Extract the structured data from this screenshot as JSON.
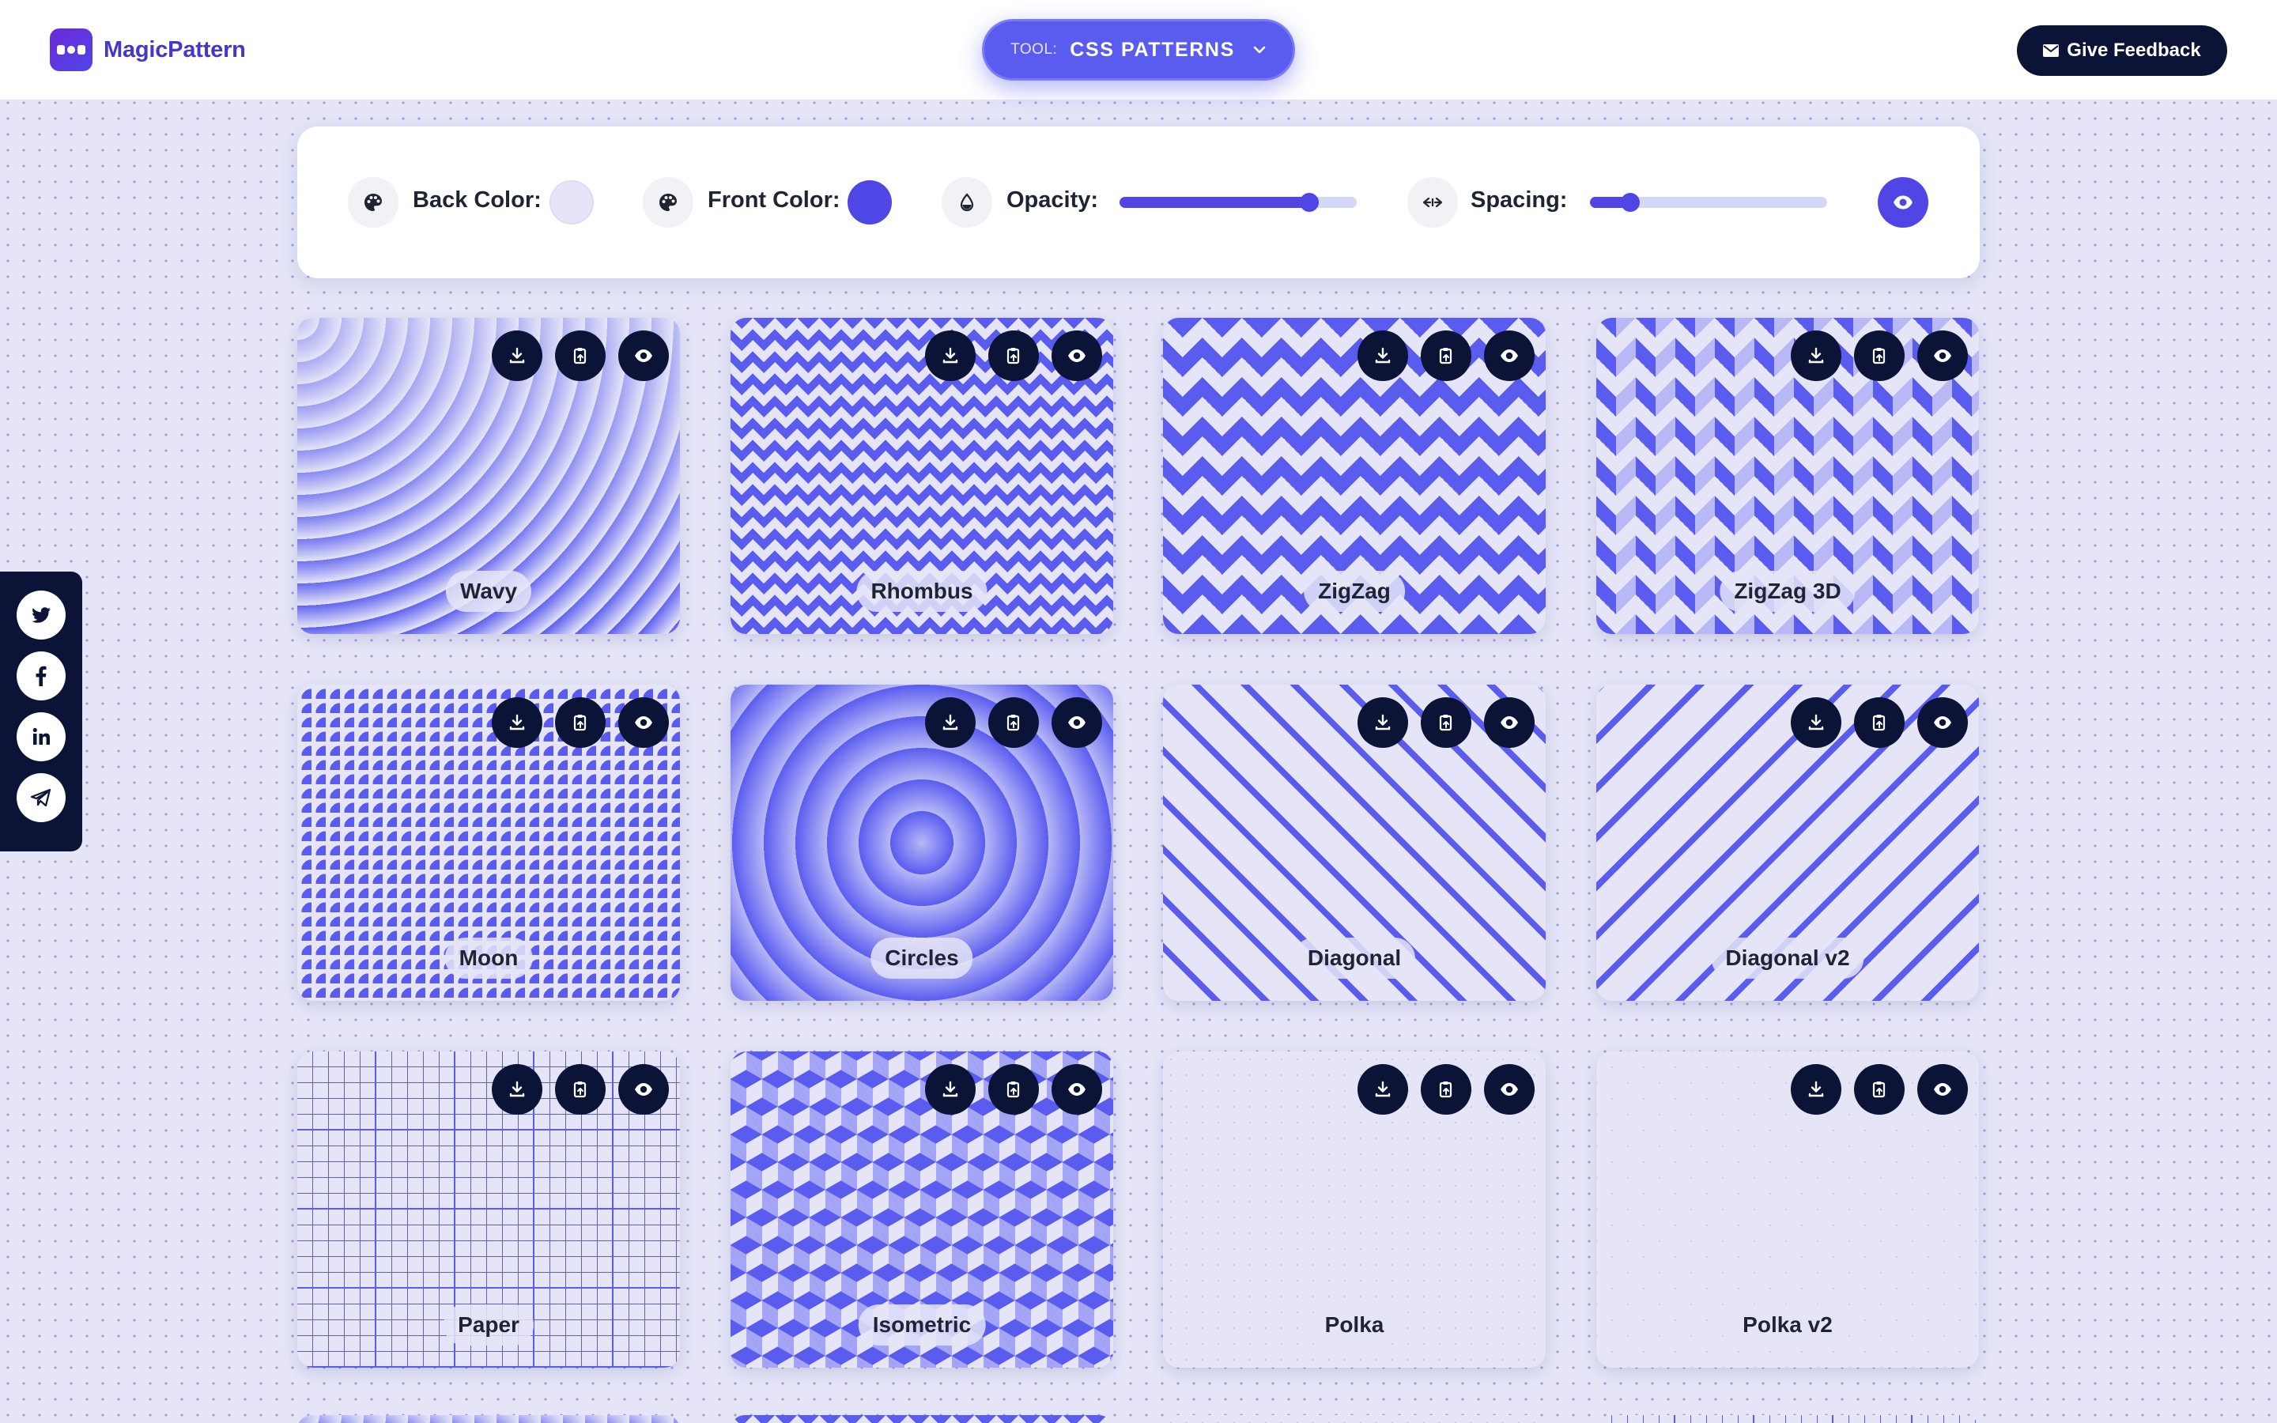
{
  "header": {
    "brand": "MagicPattern",
    "tool_prefix": "TOOL:",
    "tool_name": "CSS PATTERNS",
    "feedback_label": "Give Feedback"
  },
  "controls": {
    "back_color_label": "Back Color:",
    "back_color": "#e5e5f7",
    "front_color_label": "Front Color:",
    "front_color": "#4f46e5",
    "opacity_label": "Opacity:",
    "opacity_value": 0.8,
    "spacing_label": "Spacing:",
    "spacing_value": 0.17
  },
  "patterns": [
    {
      "name": "Wavy",
      "cls": "p-wavy"
    },
    {
      "name": "Rhombus",
      "cls": "p-rhombus"
    },
    {
      "name": "ZigZag",
      "cls": "p-zigzag"
    },
    {
      "name": "ZigZag 3D",
      "cls": "p-zigzag3d"
    },
    {
      "name": "Moon",
      "cls": "p-moon"
    },
    {
      "name": "Circles",
      "cls": "p-circles"
    },
    {
      "name": "Diagonal",
      "cls": "p-diagonal"
    },
    {
      "name": "Diagonal v2",
      "cls": "p-diagonal2"
    },
    {
      "name": "Paper",
      "cls": "p-paper"
    },
    {
      "name": "Isometric",
      "cls": "p-isometric"
    },
    {
      "name": "Polka",
      "cls": "p-polka"
    },
    {
      "name": "Polka v2",
      "cls": "p-polka2"
    }
  ],
  "card_actions": [
    "download-icon",
    "copy-css-icon",
    "preview-eye-icon"
  ],
  "social": [
    "twitter-icon",
    "facebook-icon",
    "linkedin-icon",
    "telegram-icon"
  ],
  "colors": {
    "accent": "#4f46e5",
    "dark": "#0b1437",
    "background": "#e5e5f7"
  }
}
